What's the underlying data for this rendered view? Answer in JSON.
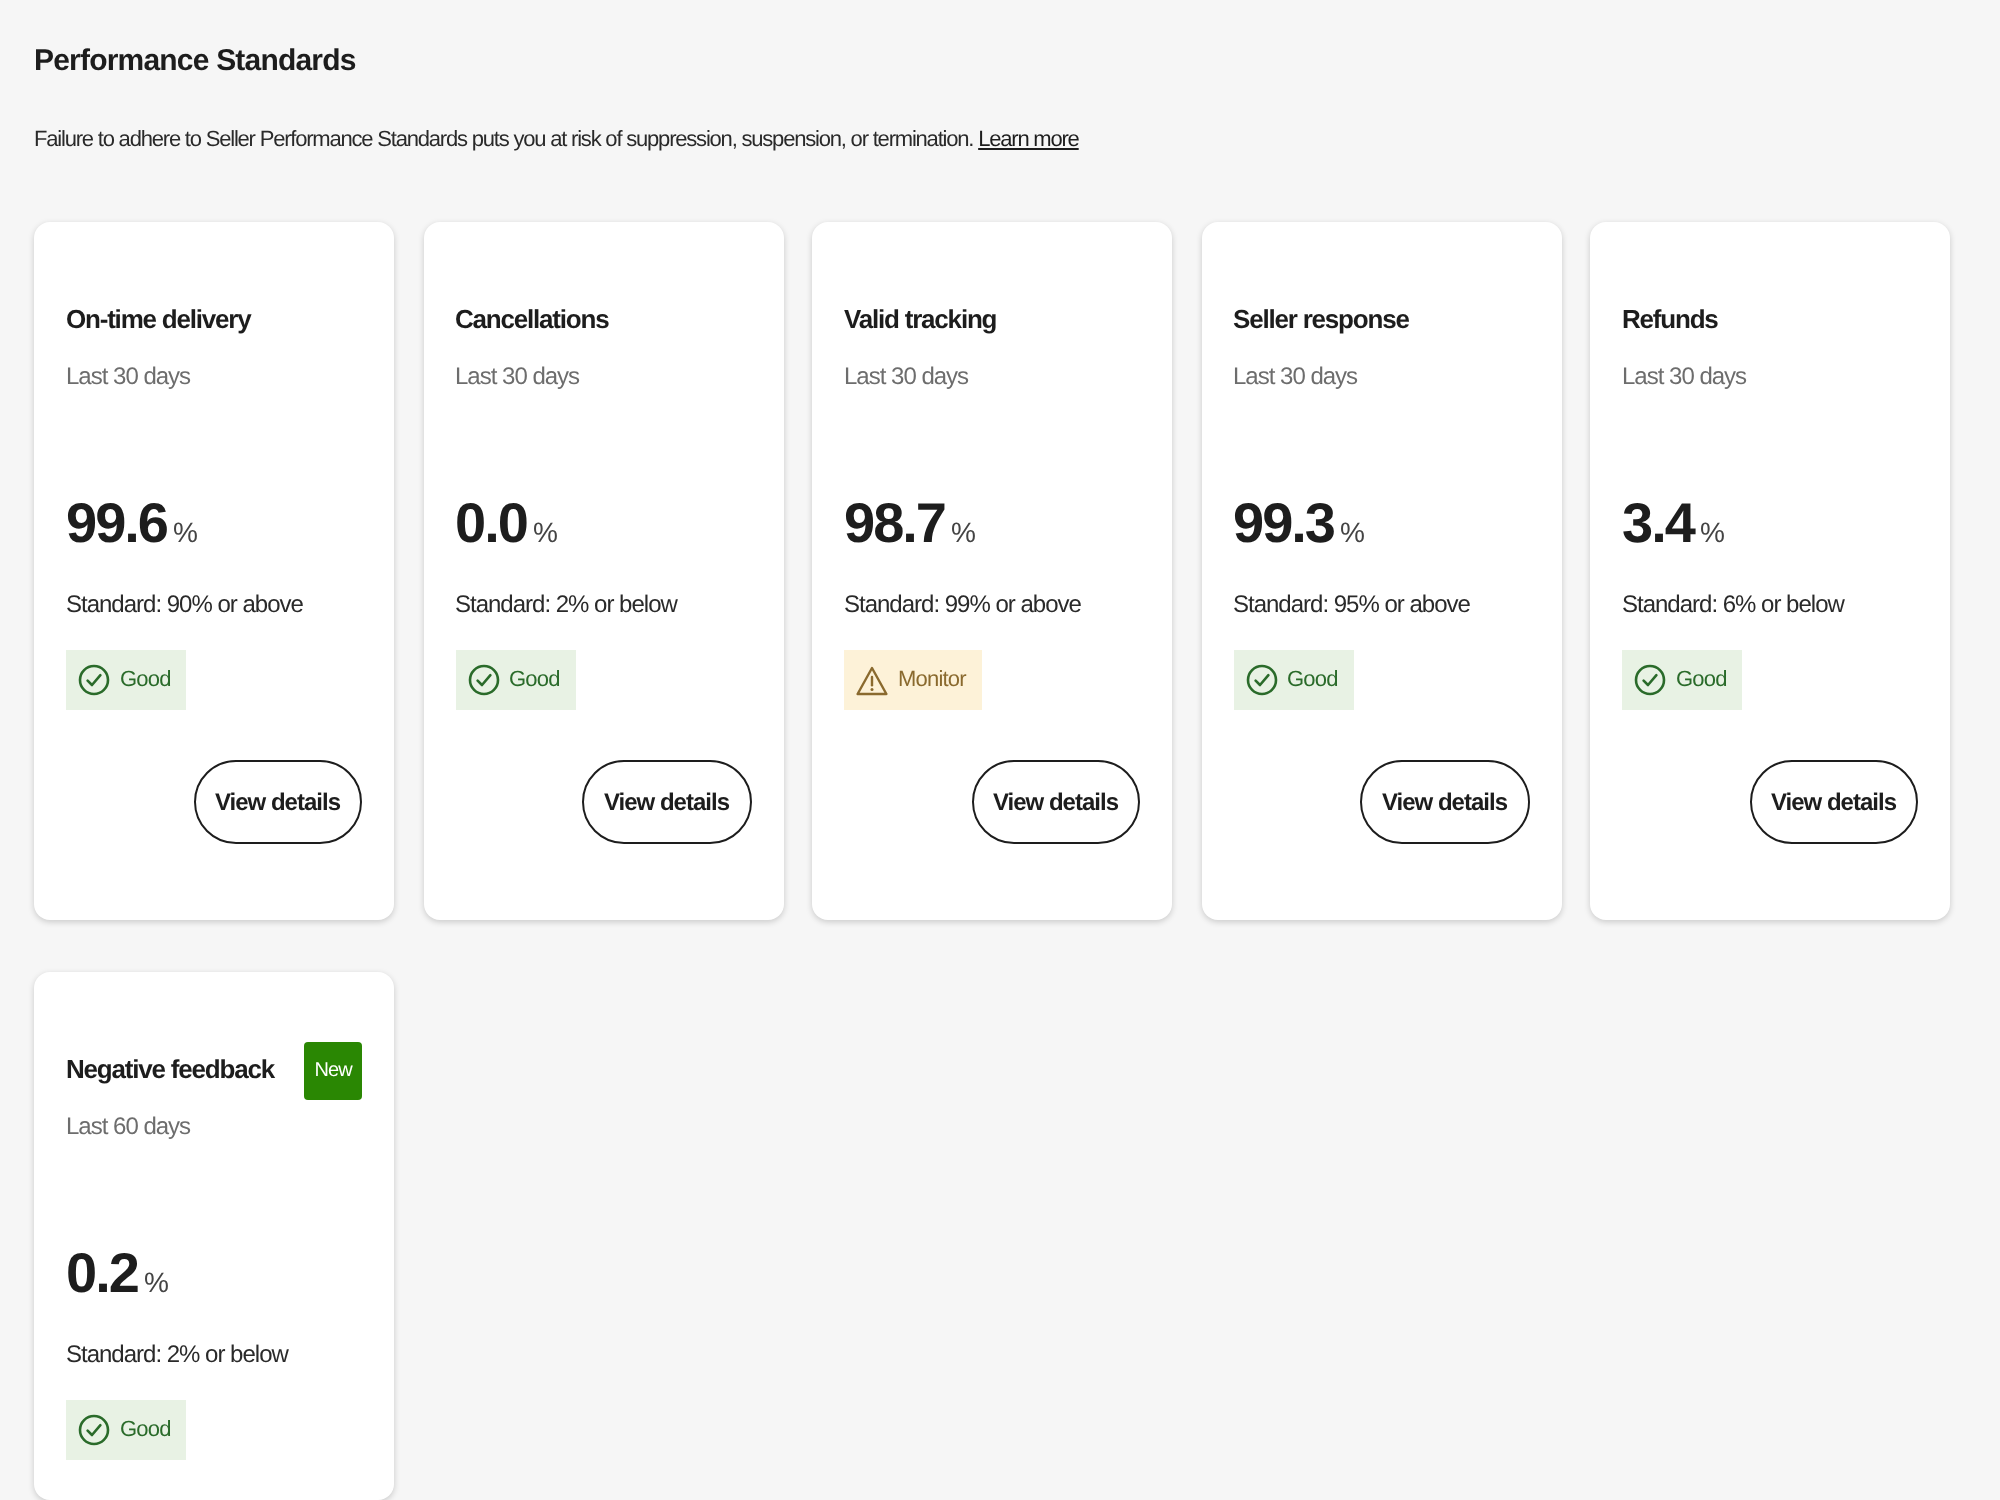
{
  "page": {
    "title": "Performance Standards",
    "notice": {
      "text": "Failure to adhere to Seller Performance Standards puts you at risk of suppression, suspension, or termination.",
      "link": "Learn more"
    }
  },
  "metrics": [
    {
      "title": "On-time delivery",
      "period": "Last 30 days",
      "value": "99.6",
      "unit": "%",
      "standard": "Standard: 90% or above",
      "status": {
        "kind": "good",
        "label": "Good"
      },
      "button": "View details"
    },
    {
      "title": "Cancellations",
      "period": "Last 30 days",
      "value": "0.0",
      "unit": "%",
      "standard": "Standard: 2% or below",
      "status": {
        "kind": "good",
        "label": "Good"
      },
      "button": "View details"
    },
    {
      "title": "Valid tracking",
      "period": "Last 30 days",
      "value": "98.7",
      "unit": "%",
      "standard": "Standard: 99% or above",
      "status": {
        "kind": "monitor",
        "label": "Monitor"
      },
      "button": "View details"
    },
    {
      "title": "Seller response",
      "period": "Last 30 days",
      "value": "99.3",
      "unit": "%",
      "standard": "Standard: 95% or above",
      "status": {
        "kind": "good",
        "label": "Good"
      },
      "button": "View details"
    },
    {
      "title": "Refunds",
      "period": "Last 30 days",
      "value": "3.4",
      "unit": "%",
      "standard": "Standard: 6% or below",
      "status": {
        "kind": "good",
        "label": "Good"
      },
      "button": "View details"
    },
    {
      "title": "Negative feedback",
      "badge": "New",
      "period": "Last 60 days",
      "value": "0.2",
      "unit": "%",
      "standard": "Standard: 2% or below",
      "status": {
        "kind": "good",
        "label": "Good"
      }
    }
  ]
}
